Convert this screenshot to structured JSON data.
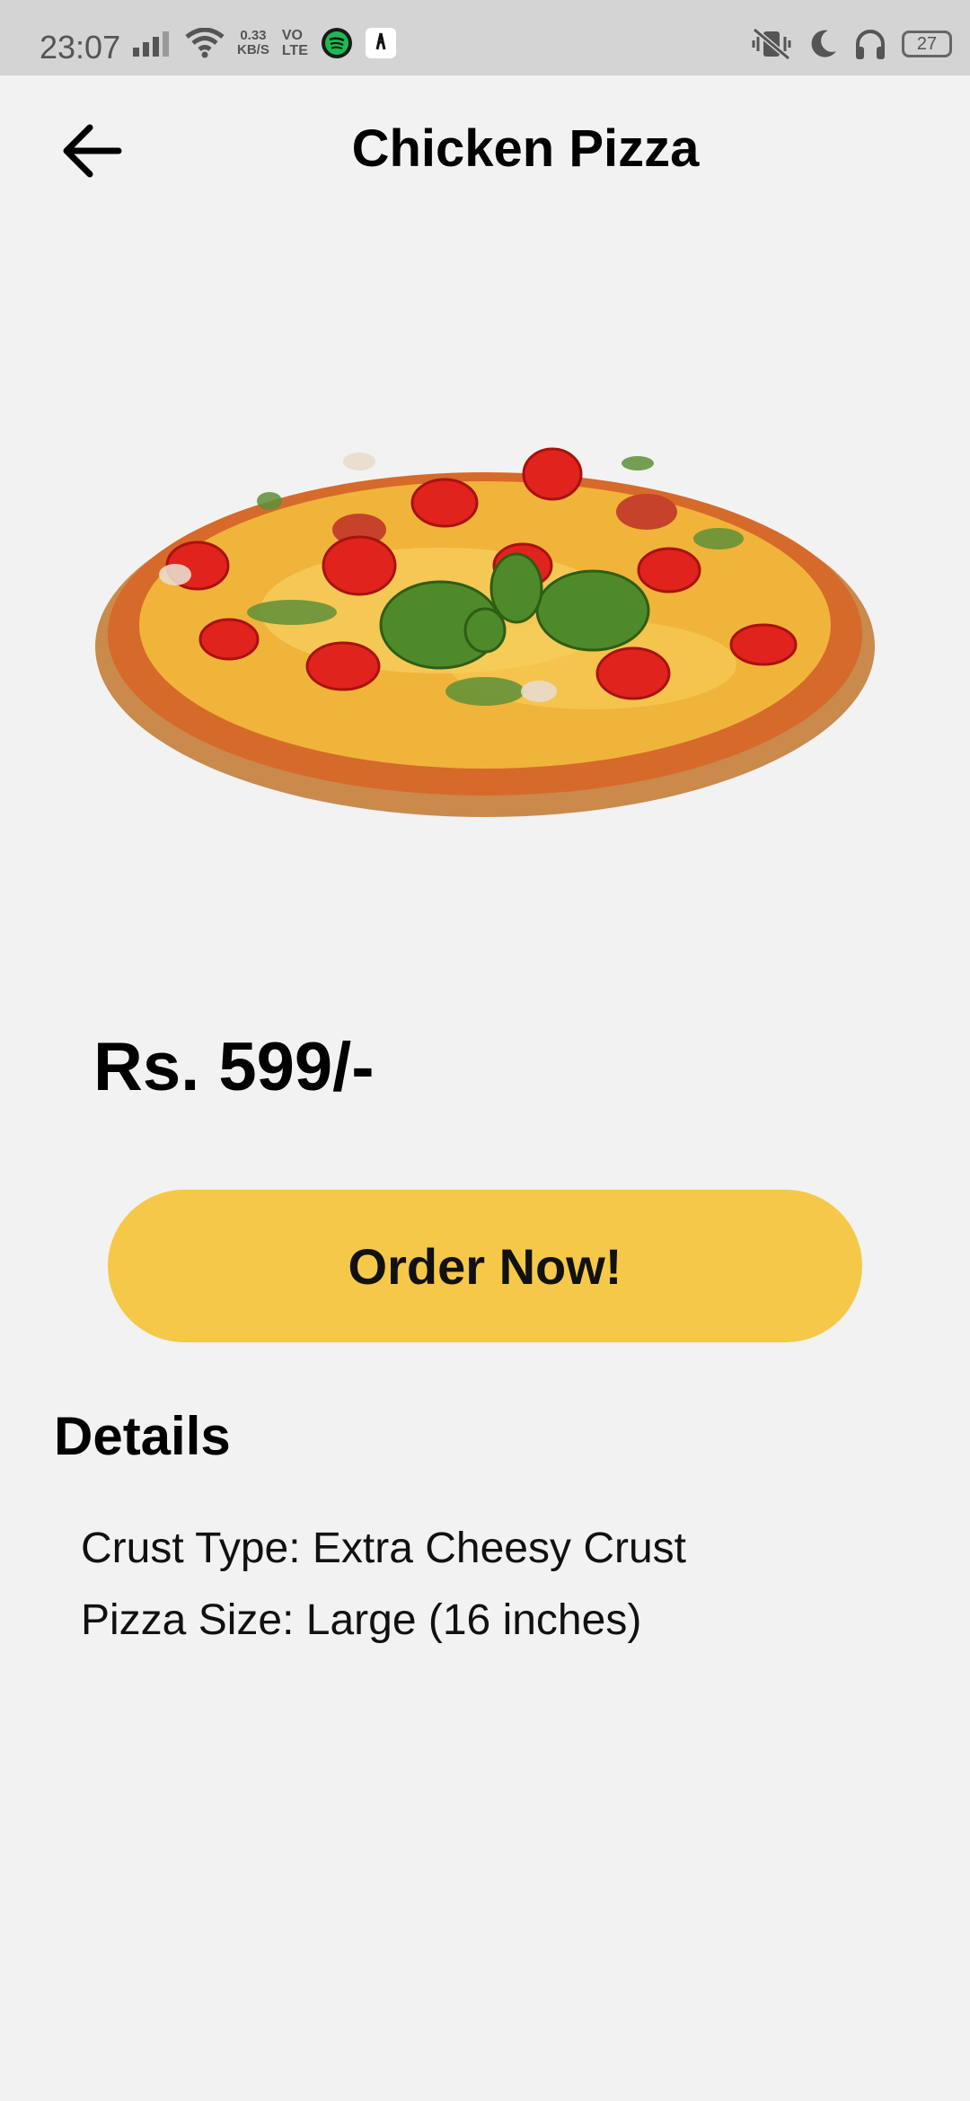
{
  "status_bar": {
    "time": "23:07",
    "speed_value": "0.33",
    "speed_unit": "KB/S",
    "volte_top": "VO",
    "volte_bottom": "LTE",
    "battery": "27",
    "icons": [
      "signal-icon",
      "wifi-icon",
      "spotify-icon",
      "app-icon",
      "mute-vibrate-icon",
      "moon-icon",
      "headphones-icon",
      "battery-icon"
    ]
  },
  "header": {
    "back_icon": "arrow-left-icon",
    "title": "Chicken Pizza"
  },
  "product": {
    "image": "pizza-image",
    "price": "Rs. 599/-"
  },
  "actions": {
    "order_label": "Order Now!",
    "order_color": "#f5c849"
  },
  "details": {
    "heading": "Details",
    "lines": [
      "Crust Type: Extra Cheesy Crust",
      "Pizza Size: Large (16 inches)"
    ]
  }
}
